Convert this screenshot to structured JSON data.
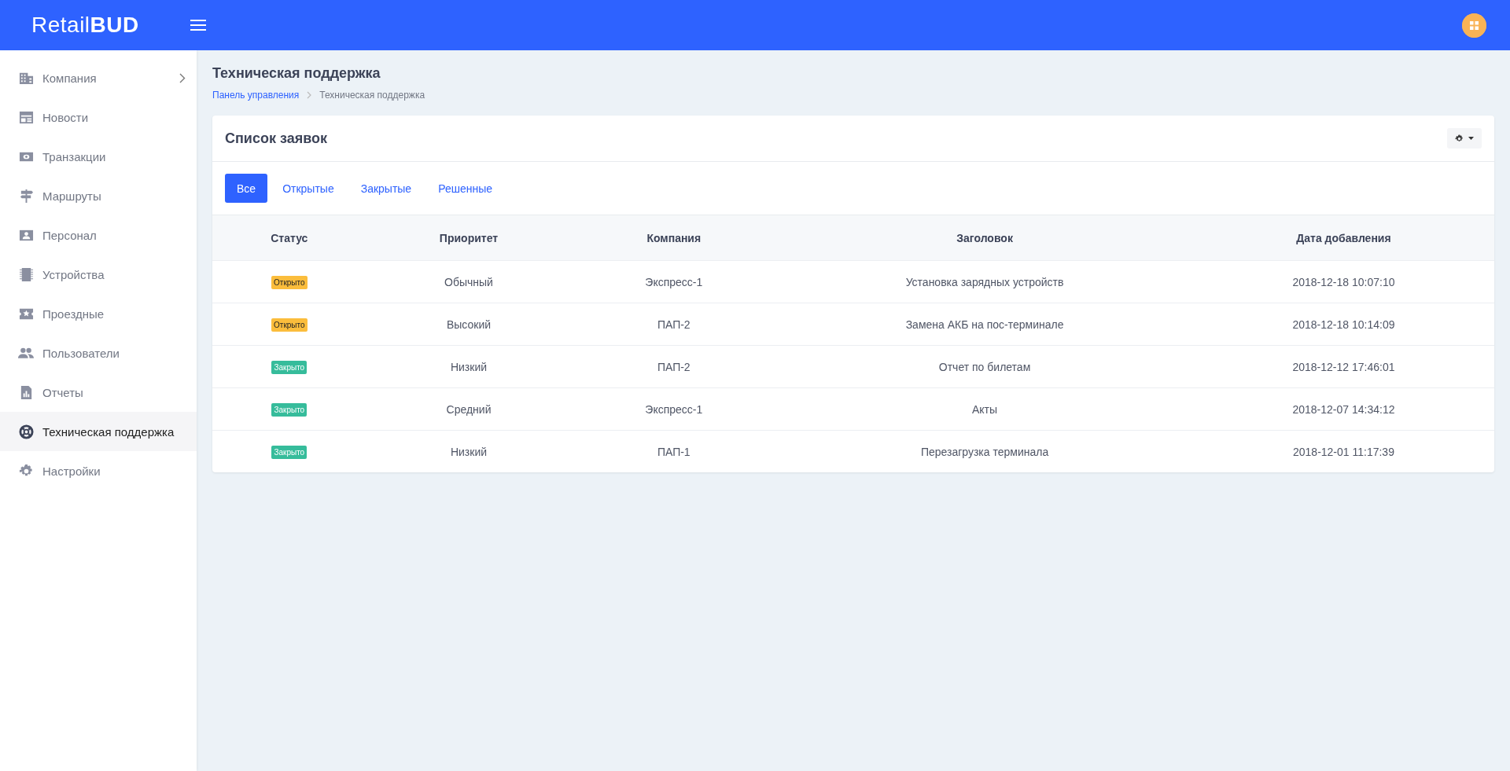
{
  "header": {
    "logo_light": "Retail",
    "logo_bold": "BUD"
  },
  "sidebar": {
    "items": [
      {
        "label": "Компания",
        "kind": "group",
        "selected": false
      },
      {
        "label": "Новости",
        "kind": "link",
        "selected": false
      },
      {
        "label": "Транзакции",
        "kind": "link",
        "selected": false
      },
      {
        "label": "Маршруты",
        "kind": "link",
        "selected": false
      },
      {
        "label": "Персонал",
        "kind": "link",
        "selected": false
      },
      {
        "label": "Устройства",
        "kind": "link",
        "selected": false
      },
      {
        "label": "Проездные",
        "kind": "link",
        "selected": false
      },
      {
        "label": "Пользователи",
        "kind": "link",
        "selected": false
      },
      {
        "label": "Отчеты",
        "kind": "link",
        "selected": false
      },
      {
        "label": "Техническая поддержка",
        "kind": "link",
        "selected": true
      },
      {
        "label": "Настройки",
        "kind": "link",
        "selected": false
      }
    ]
  },
  "page": {
    "title": "Техническая поддержка",
    "breadcrumb": [
      "Панель управления",
      "Техническая поддержка"
    ]
  },
  "card": {
    "title": "Список заявок",
    "tabs": [
      {
        "label": "Все",
        "selected": true
      },
      {
        "label": "Открытые",
        "selected": false
      },
      {
        "label": "Закрытые",
        "selected": false
      },
      {
        "label": "Решенные",
        "selected": false
      }
    ],
    "table": {
      "columns": [
        "Статус",
        "Приоритет",
        "Компания",
        "Заголовок",
        "Дата добавления"
      ],
      "rows": [
        {
          "status": {
            "label": "Открыто",
            "kind": "open"
          },
          "priority": "Обычный",
          "company": "Экспресс-1",
          "title": "Установка зарядных устройств",
          "date": "2018-12-18 10:07:10"
        },
        {
          "status": {
            "label": "Открыто",
            "kind": "open"
          },
          "priority": "Высокий",
          "company": "ПАП-2",
          "title": "Замена АКБ на пос-терминале",
          "date": "2018-12-18 10:14:09"
        },
        {
          "status": {
            "label": "Закрыто",
            "kind": "closed"
          },
          "priority": "Низкий",
          "company": "ПАП-2",
          "title": "Отчет по билетам",
          "date": "2018-12-12 17:46:01"
        },
        {
          "status": {
            "label": "Закрыто",
            "kind": "closed"
          },
          "priority": "Средний",
          "company": "Экспресс-1",
          "title": "Акты",
          "date": "2018-12-07 14:34:12"
        },
        {
          "status": {
            "label": "Закрыто",
            "kind": "closed"
          },
          "priority": "Низкий",
          "company": "ПАП-1",
          "title": "Перезагрузка терминала",
          "date": "2018-12-01 11:17:39"
        }
      ]
    }
  }
}
